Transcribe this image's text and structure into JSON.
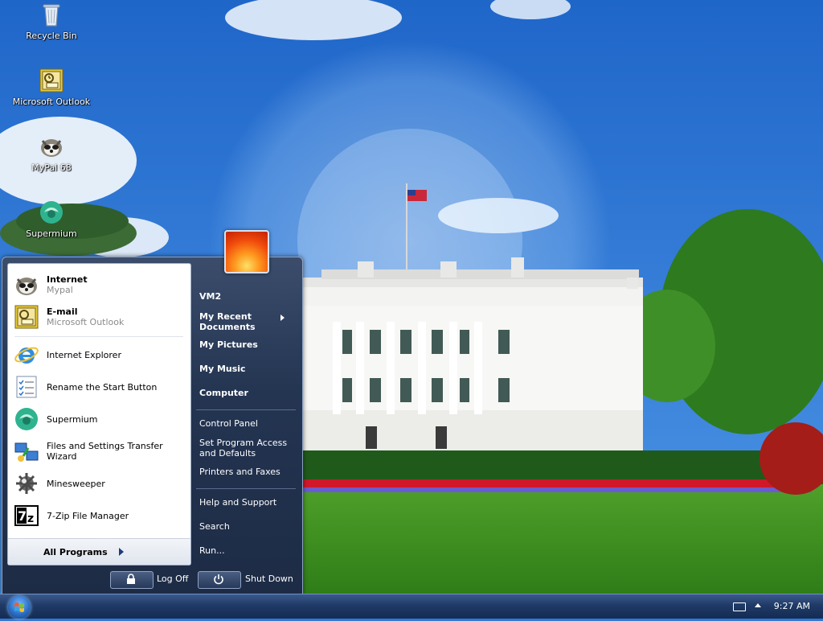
{
  "desktop": {
    "icons": [
      {
        "label": "Recycle Bin",
        "icon": "recycle-bin-icon"
      },
      {
        "label": "Microsoft Outlook",
        "icon": "outlook-icon"
      },
      {
        "label": "MyPal 68",
        "icon": "mypal-icon"
      },
      {
        "label": "Supermium",
        "icon": "supermium-icon"
      }
    ]
  },
  "start_menu": {
    "pinned": [
      {
        "title": "Internet",
        "subtitle": "Mypal",
        "icon": "mypal-icon"
      },
      {
        "title": "E-mail",
        "subtitle": "Microsoft Outlook",
        "icon": "outlook-icon"
      }
    ],
    "recent": [
      {
        "title": "Internet Explorer",
        "icon": "internet-explorer-icon"
      },
      {
        "title": "Rename the Start Button",
        "icon": "checklist-icon"
      },
      {
        "title": "Supermium",
        "icon": "supermium-icon"
      },
      {
        "title": "Files and Settings Transfer Wizard",
        "icon": "transfer-wizard-icon"
      },
      {
        "title": "Minesweeper",
        "icon": "minesweeper-icon"
      },
      {
        "title": "7-Zip File Manager",
        "icon": "7zip-icon"
      }
    ],
    "all_programs": "All Programs",
    "right": {
      "user": "VM2",
      "recent_documents": "My Recent Documents",
      "pictures": "My Pictures",
      "music": "My Music",
      "computer": "Computer",
      "control_panel": "Control Panel",
      "program_access": "Set Program Access and Defaults",
      "printers": "Printers and Faxes",
      "help": "Help and Support",
      "search": "Search",
      "run": "Run..."
    },
    "log_off": "Log Off",
    "shut_down": "Shut Down"
  },
  "taskbar": {
    "clock": "9:27 AM"
  },
  "colors": {
    "taskbar": "#1f3a66",
    "menu_dark": "#243552",
    "sky": "#2f78d6"
  }
}
